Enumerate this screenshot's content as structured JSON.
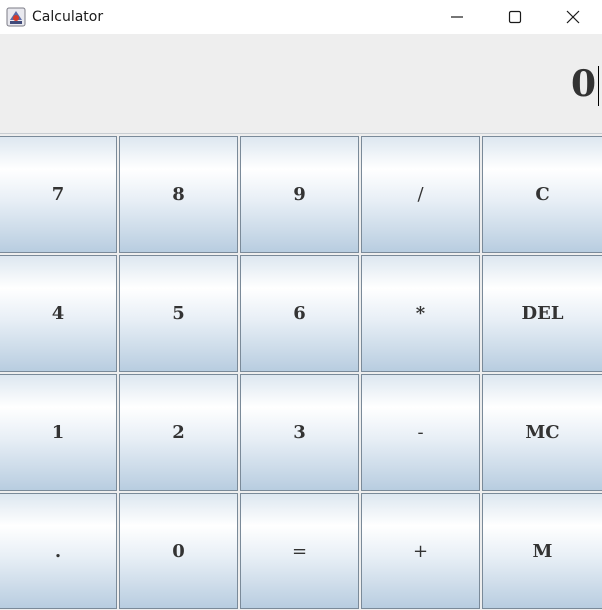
{
  "window": {
    "title": "Calculator",
    "icon": "java-cup-icon",
    "controls": {
      "minimize": "minimize-icon",
      "maximize": "maximize-icon",
      "close": "close-icon"
    }
  },
  "display": {
    "value": "0"
  },
  "keypad": {
    "rows": [
      [
        "7",
        "8",
        "9",
        "/",
        "C"
      ],
      [
        "4",
        "5",
        "6",
        "*",
        "DEL"
      ],
      [
        "1",
        "2",
        "3",
        "-",
        "MC"
      ],
      [
        ".",
        "0",
        "=",
        "+",
        "M"
      ]
    ]
  },
  "colors": {
    "key_border": "#7a8a99",
    "key_gradient_top": "#ffffff",
    "key_gradient_bottom": "#b8cde0",
    "display_bg": "#eeeeee",
    "text": "#333333"
  }
}
